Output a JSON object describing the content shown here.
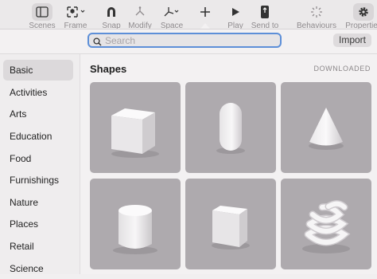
{
  "toolbar": {
    "items": [
      {
        "label": "Scenes",
        "icon": "sidebar-icon"
      },
      {
        "label": "Frame",
        "icon": "frame-icon"
      },
      {
        "label": "Snap",
        "icon": "magnet-icon"
      },
      {
        "label": "Modify",
        "icon": "modify-icon"
      },
      {
        "label": "Space",
        "icon": "space-icon"
      },
      {
        "label": "",
        "icon": "plus-icon"
      },
      {
        "label": "Play",
        "icon": "play-icon"
      },
      {
        "label": "Send to",
        "icon": "send-to-icon"
      },
      {
        "label": "Behaviours",
        "icon": "behaviours-icon"
      },
      {
        "label": "Properties",
        "icon": "gear-icon"
      }
    ]
  },
  "search": {
    "placeholder": "Search",
    "value": ""
  },
  "import_label": "Import",
  "sidebar": {
    "items": [
      {
        "label": "Basic",
        "active": true
      },
      {
        "label": "Activities"
      },
      {
        "label": "Arts"
      },
      {
        "label": "Education"
      },
      {
        "label": "Food"
      },
      {
        "label": "Furnishings"
      },
      {
        "label": "Nature"
      },
      {
        "label": "Places"
      },
      {
        "label": "Retail"
      },
      {
        "label": "Science"
      }
    ]
  },
  "content": {
    "title": "Shapes",
    "downloaded": "DOWNLOADED",
    "shapes": [
      {
        "name": "cube-shape"
      },
      {
        "name": "capsule-shape"
      },
      {
        "name": "cone-shape"
      },
      {
        "name": "cylinder-shape"
      },
      {
        "name": "box-shape"
      },
      {
        "name": "coil-shape"
      }
    ]
  },
  "colors": {
    "accent": "#5d8fd8",
    "tile": "#aeaaae",
    "shape": "#f0eef0"
  }
}
